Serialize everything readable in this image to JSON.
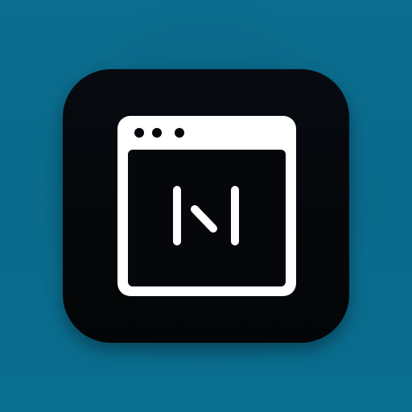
{
  "app_icon": {
    "icon": "browser-window-n-icon",
    "colors": {
      "background": "#0a6b8c",
      "tile": "#05070b",
      "window": "#ffffff",
      "glyph": "#ffffff"
    },
    "window_dots": 3
  }
}
